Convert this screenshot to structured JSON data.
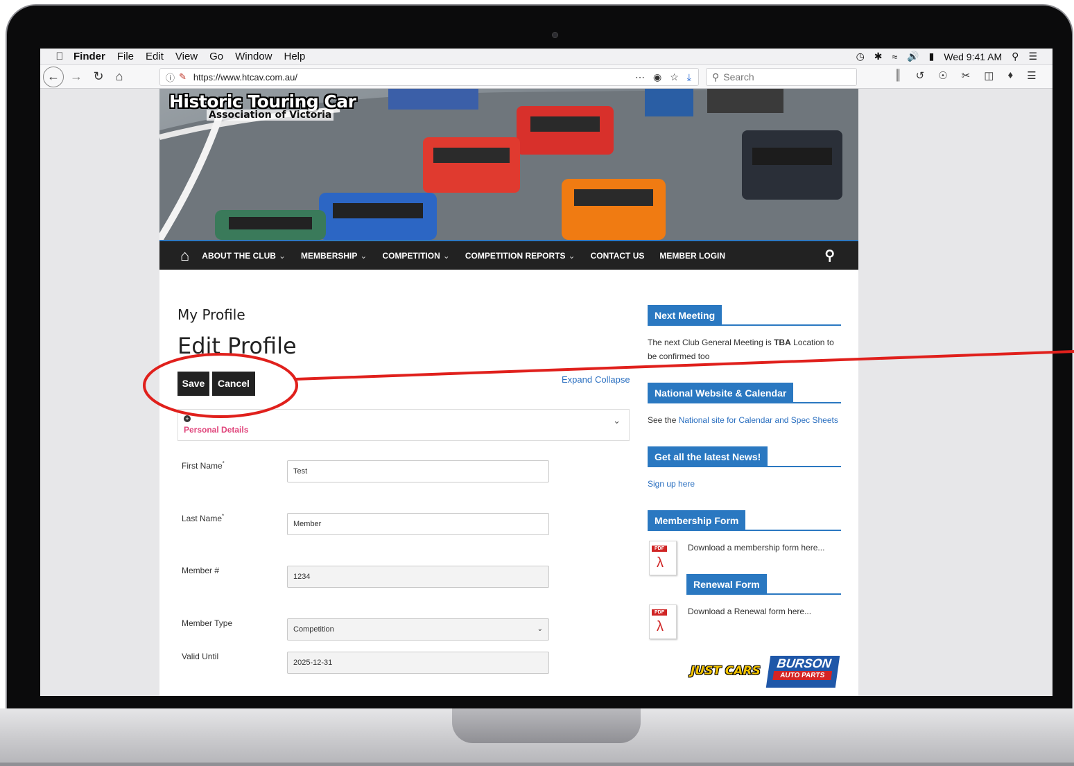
{
  "mac_menubar": {
    "app": "Finder",
    "items": [
      "File",
      "Edit",
      "View",
      "Go",
      "Window",
      "Help"
    ],
    "clock": "Wed 9:41 AM"
  },
  "browser": {
    "url": "https://www.htcav.com.au/",
    "search_placeholder": "Search"
  },
  "hero": {
    "logo_title": "Historic Touring Car",
    "logo_subtitle": "Association of Victoria"
  },
  "nav": {
    "items": [
      {
        "label": "ABOUT THE CLUB",
        "has_dropdown": true
      },
      {
        "label": "MEMBERSHIP",
        "has_dropdown": true
      },
      {
        "label": "COMPETITION",
        "has_dropdown": true
      },
      {
        "label": "COMPETITION REPORTS",
        "has_dropdown": true
      },
      {
        "label": "CONTACT US",
        "has_dropdown": false
      },
      {
        "label": "MEMBER LOGIN",
        "has_dropdown": false
      }
    ]
  },
  "content": {
    "page_heading": "My Profile",
    "form_heading": "Edit Profile",
    "save_label": "Save",
    "cancel_label": "Cancel",
    "expand_label": "Expand",
    "collapse_label": "Collapse",
    "section_title": "Personal Details",
    "fields": {
      "first_name": {
        "label": "First Name",
        "required": true,
        "value": "Test"
      },
      "last_name": {
        "label": "Last Name",
        "required": true,
        "value": "Member"
      },
      "member_number": {
        "label": "Member #",
        "value": "1234"
      },
      "member_type": {
        "label": "Member Type",
        "value": "Competition"
      },
      "valid_until": {
        "label": "Valid Until",
        "value": "2025-12-31"
      }
    }
  },
  "sidebar": {
    "next_meeting": {
      "heading": "Next Meeting",
      "text_before": "The next Club General Meeting is ",
      "text_bold": "TBA",
      "text_after": " Location to be confirmed too"
    },
    "national": {
      "heading": "National Website & Calendar",
      "text_before": "See the ",
      "link": "National site for Calendar and Spec Sheets"
    },
    "news": {
      "heading": "Get all the latest News!",
      "link": "Sign up here"
    },
    "membership_form": {
      "heading": "Membership Form",
      "text": "Download a membership form here..."
    },
    "renewal_form": {
      "heading": "Renewal Form",
      "text": "Download a Renewal form here..."
    },
    "sponsors": {
      "just_cars": "JUST CARS",
      "burson_name": "BURSON",
      "burson_tag": "AUTO PARTS"
    },
    "pdf_tag": "PDF"
  },
  "colors": {
    "nav_bg": "#222222",
    "accent_blue": "#2a78c1",
    "section_pink": "#e0457b",
    "annotation_red": "#e0201c"
  }
}
